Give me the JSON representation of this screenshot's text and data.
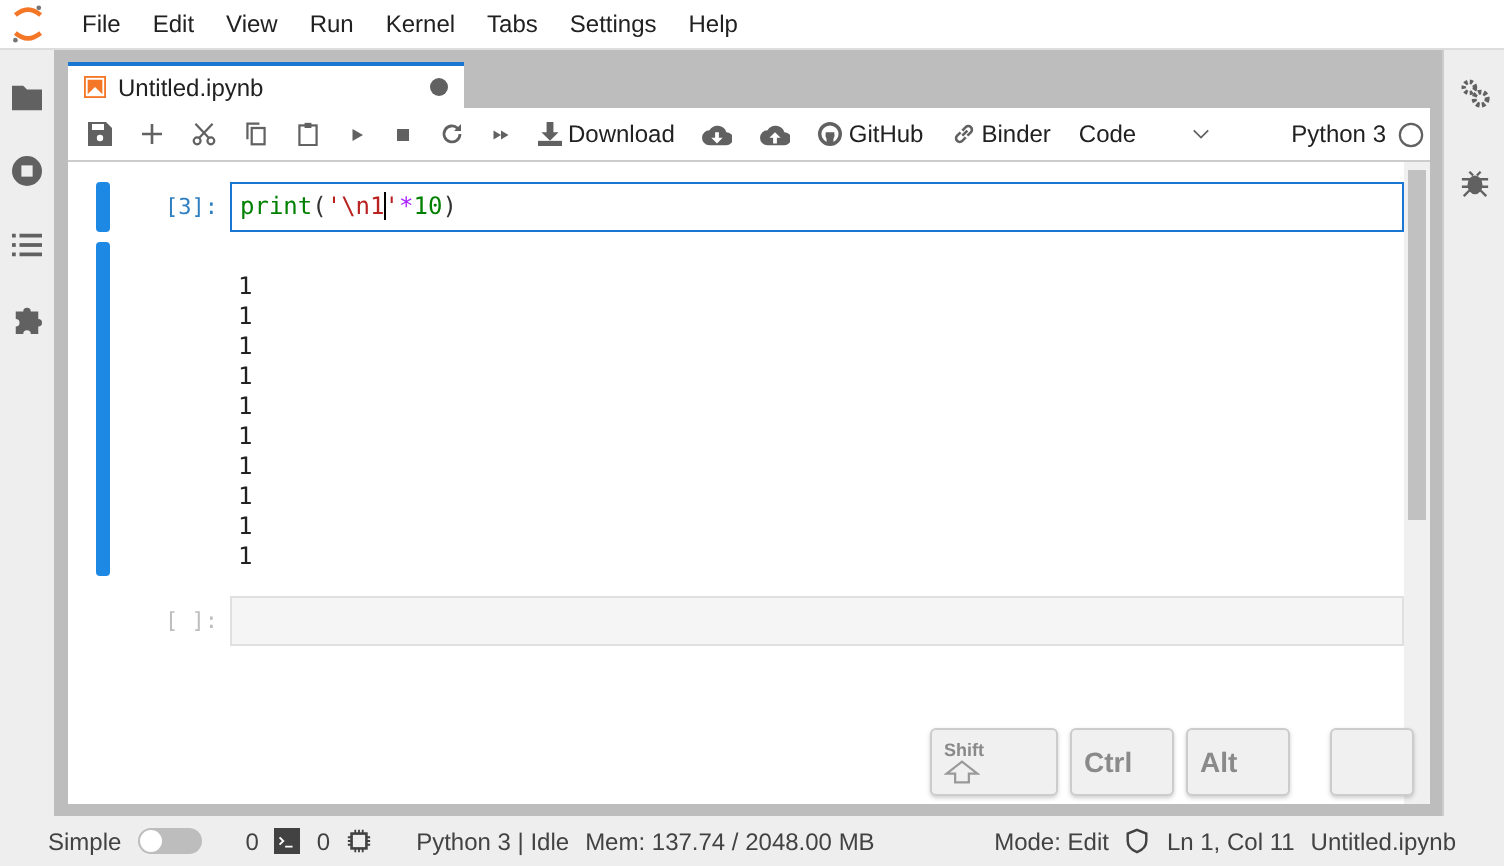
{
  "menu": [
    "File",
    "Edit",
    "View",
    "Run",
    "Kernel",
    "Tabs",
    "Settings",
    "Help"
  ],
  "tabs": [
    {
      "label": "Untitled.ipynb",
      "selected": true,
      "modified": true
    }
  ],
  "toolbar_buttons": [
    {
      "label": "Download"
    },
    {
      "label": "GitHub"
    },
    {
      "label": "Binder"
    }
  ],
  "cell_type": "Code",
  "kernel": {
    "name": "Python 3",
    "busy": false
  },
  "cells": [
    {
      "prompt": "[3]:",
      "active": true,
      "tokens": [
        {
          "kind": "builtin",
          "text": "print"
        },
        {
          "kind": "plain",
          "text": "("
        },
        {
          "kind": "string",
          "text": "'\\n1"
        },
        {
          "kind": "cursor"
        },
        {
          "kind": "string",
          "text": "'"
        },
        {
          "kind": "operator",
          "text": "*"
        },
        {
          "kind": "number",
          "text": "10"
        },
        {
          "kind": "plain",
          "text": ")"
        }
      ],
      "output": "\n1\n1\n1\n1\n1\n1\n1\n1\n1\n1"
    },
    {
      "prompt": "[ ]:",
      "active": false
    }
  ],
  "keys": [
    {
      "label": "Shift",
      "kind": "shift"
    },
    {
      "label": "Ctrl",
      "kind": "plain"
    },
    {
      "label": "Alt",
      "kind": "plain"
    },
    {
      "kind": "blank"
    }
  ],
  "status": {
    "mode_label": "Simple",
    "simple": false,
    "terminals": "0",
    "kernels": "0",
    "kernel_status": "Python 3 | Idle",
    "memory": "Mem: 137.74 / 2048.00 MB",
    "mode": "Mode: Edit",
    "position": "Ln 1, Col 11",
    "file": "Untitled.ipynb"
  }
}
